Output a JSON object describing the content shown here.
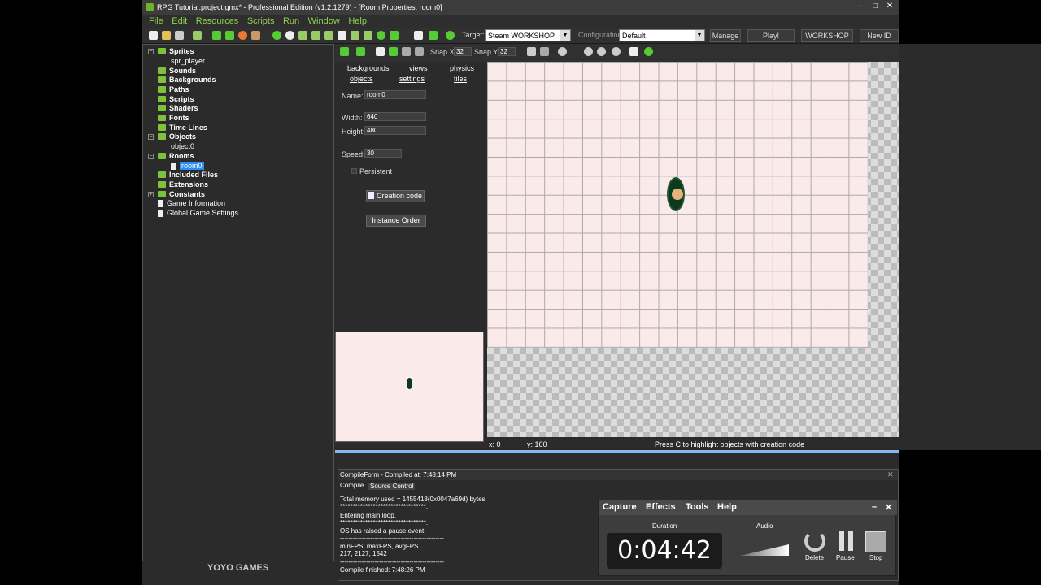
{
  "window": {
    "title": "RPG Tutorial.project.gmx*  -  Professional Edition (v1.2.1279)  -  [Room Properties: room0]"
  },
  "menu": [
    "File",
    "Edit",
    "Resources",
    "Scripts",
    "Run",
    "Window",
    "Help"
  ],
  "toolbar": {
    "target_label": "Target:",
    "target_value": "Steam WORKSHOP",
    "configuration_label": "Configuration:",
    "configuration_value": "Default",
    "manage_label": "Manage",
    "play_label": "Play!",
    "workshop_label": "WORKSHOP",
    "newid_label": "New ID"
  },
  "tree": {
    "sprites": "Sprites",
    "spr_player": "spr_player",
    "sounds": "Sounds",
    "backgrounds": "Backgrounds",
    "paths": "Paths",
    "scripts": "Scripts",
    "shaders": "Shaders",
    "fonts": "Fonts",
    "timelines": "Time Lines",
    "objects": "Objects",
    "object0": "object0",
    "rooms": "Rooms",
    "room0": "room0",
    "included": "Included Files",
    "extensions": "Extensions",
    "constants": "Constants",
    "gameinfo": "Game Information",
    "globalsettings": "Global Game Settings"
  },
  "logo": "YOYO GAMES",
  "room": {
    "snapx_label": "Snap X",
    "snapx": "32",
    "snapy_label": "Snap Y",
    "snapy": "32",
    "tabs": [
      "backgrounds",
      "views",
      "physics",
      "objects",
      "settings",
      "tiles"
    ],
    "name_label": "Name:",
    "name": "room0",
    "width_label": "Width:",
    "width": "640",
    "height_label": "Height:",
    "height": "480",
    "speed_label": "Speed:",
    "speed": "30",
    "persistent_label": "Persistent",
    "creation_code_label": "Creation code",
    "instance_order_label": "Instance Order",
    "status_x": "x: 0",
    "status_y": "y: 160",
    "status_hint": "Press C to highlight objects with creation code"
  },
  "compile": {
    "title": "CompileForm - Compiled at: 7:48:14 PM",
    "tab_compile": "Compile",
    "tab_source": "Source Control",
    "lines": [
      "Total memory used = 1455418(0x0047a69d) bytes",
      "**********************************.",
      "Entering main loop.",
      "**********************************.",
      "OS has raised a pause event",
      "------------------------------------------------",
      "minFPS, maxFPS, avgFPS",
      "217, 2127, 1542",
      "------------------------------------------------",
      "Compile finished: 7:48:26 PM"
    ]
  },
  "capture": {
    "menu": [
      "Capture",
      "Effects",
      "Tools",
      "Help"
    ],
    "duration_label": "Duration",
    "duration": "0:04:42",
    "audio_label": "Audio",
    "delete_label": "Delete",
    "pause_label": "Pause",
    "stop_label": "Stop"
  }
}
